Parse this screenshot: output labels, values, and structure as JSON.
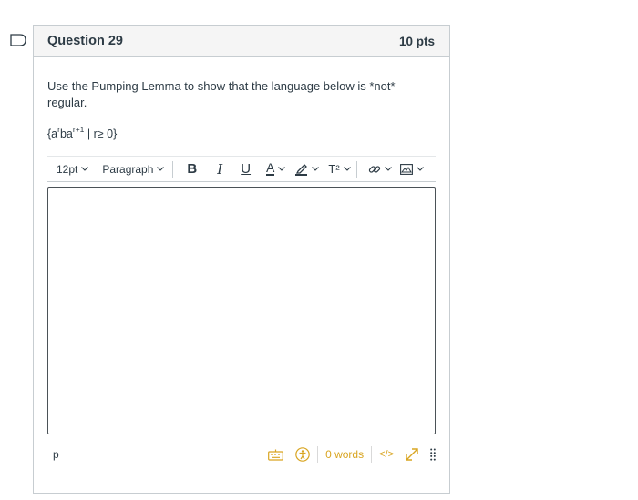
{
  "question": {
    "title": "Question 29",
    "points": "10 pts",
    "prompt": "Use the Pumping Lemma to show that the language below is *not* regular.",
    "language": {
      "open": "{a",
      "exp1": "r",
      "mid": "ba",
      "exp2": "r+1",
      "rest": " | r≥ 0}"
    }
  },
  "toolbar": {
    "font_size": "12pt",
    "block_format": "Paragraph",
    "bold": "B",
    "italic": "I",
    "underline": "U",
    "text_color": "A",
    "superscript": "T²"
  },
  "editor": {
    "path": "p",
    "word_count": "0 words",
    "html_toggle": "</>"
  },
  "colors": {
    "accent": "#d9a521",
    "text": "#2d3b45",
    "border": "#c7cdd1"
  }
}
